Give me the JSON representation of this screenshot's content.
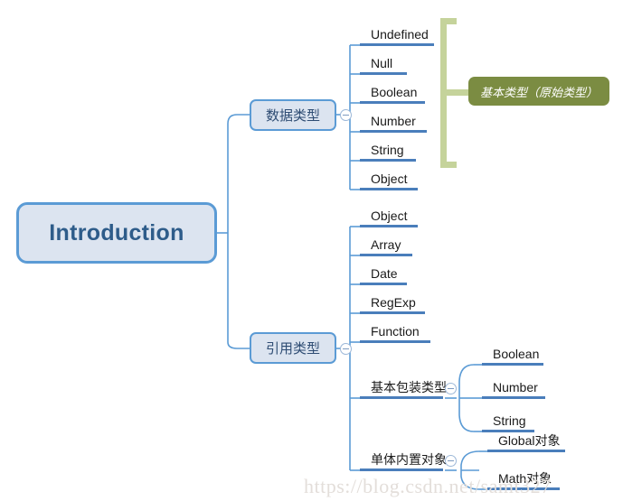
{
  "diagram": {
    "title": "Introduction",
    "root": {
      "label": "Introduction"
    },
    "branches": [
      {
        "label": "数据类型",
        "toggle": "collapse-toggle"
      },
      {
        "label": "引用类型",
        "toggle": "collapse-toggle"
      }
    ],
    "data_type_leaves": [
      {
        "label": "Undefined"
      },
      {
        "label": "Null"
      },
      {
        "label": "Boolean"
      },
      {
        "label": "Number"
      },
      {
        "label": "String"
      },
      {
        "label": "Object"
      }
    ],
    "reference_type_leaves": [
      {
        "label": "Object"
      },
      {
        "label": "Array"
      },
      {
        "label": "Date"
      },
      {
        "label": "RegExp"
      },
      {
        "label": "Function"
      }
    ],
    "sub_branches": [
      {
        "label": "基本包装类型",
        "toggle": "collapse-toggle"
      },
      {
        "label": "单体内置对象",
        "toggle": "collapse-toggle"
      }
    ],
    "wrapper_type_leaves": [
      {
        "label": "Boolean"
      },
      {
        "label": "Number"
      },
      {
        "label": "String"
      }
    ],
    "builtin_object_leaves": [
      {
        "label": "Global对象"
      },
      {
        "label": "Math对象"
      }
    ],
    "callout": {
      "label": "基本类型（原始类型）"
    },
    "watermark": "https://blog.csdn.net/samt327",
    "colors": {
      "node_border": "#5B9BD5",
      "node_fill": "#DCE4F0",
      "root_text": "#2E5C8A",
      "branch_text": "#2E4C73",
      "connector": "#5B9BD5",
      "leaf_underline": "#4A7EBB",
      "leaf_text": "#1A1A1A",
      "callout_fill": "#7B8C42",
      "callout_bracket": "#C5D39B",
      "callout_text": "#FFFFFF",
      "watermark_text": "#E3DEDA",
      "background": "#FFFFFF"
    }
  }
}
